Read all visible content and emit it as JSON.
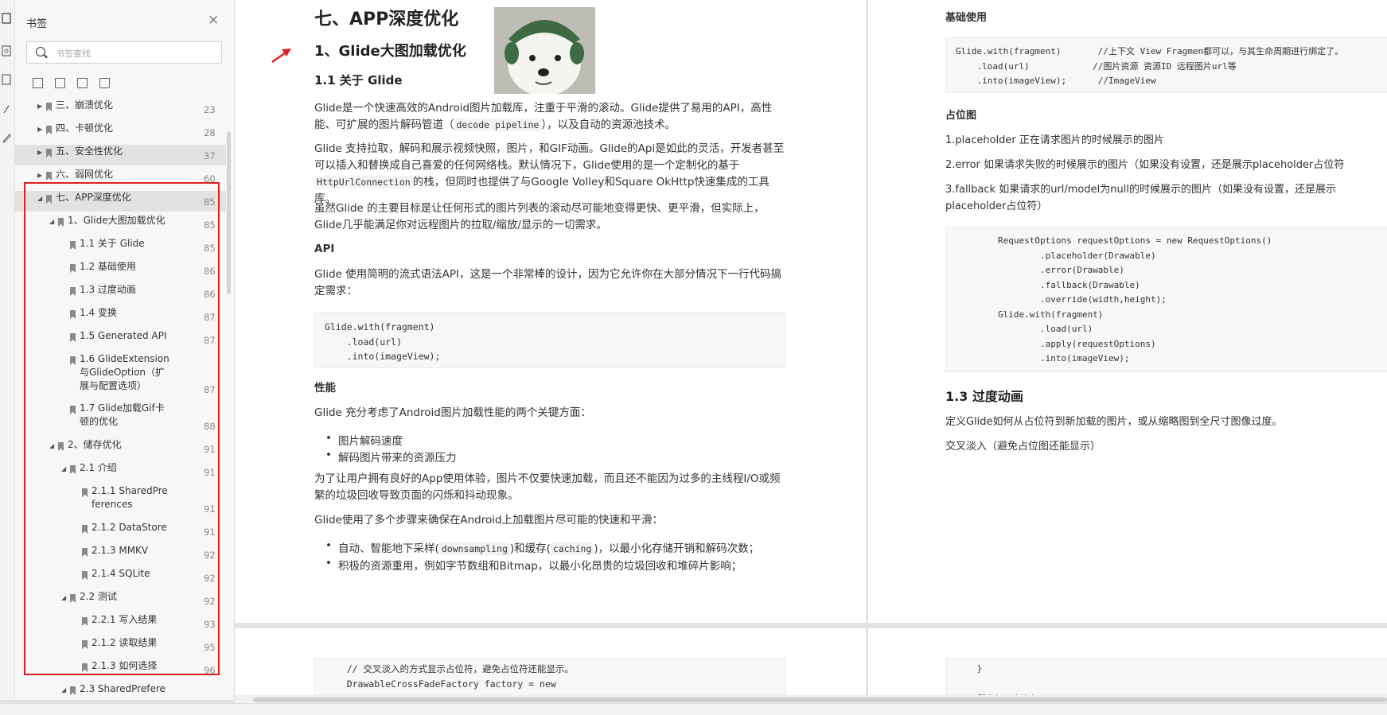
{
  "sidebar": {
    "title": "书签",
    "search_placeholder": "书签查找",
    "items": [
      {
        "label": "三、崩溃优化",
        "page": "23",
        "level": 0,
        "expanded": false,
        "highlight": false
      },
      {
        "label": "四、卡顿优化",
        "page": "28",
        "level": 0,
        "expanded": false,
        "highlight": false
      },
      {
        "label": "五、安全性优化",
        "page": "37",
        "level": 0,
        "expanded": false,
        "highlight": true
      },
      {
        "label": "六、弱网优化",
        "page": "60",
        "level": 0,
        "expanded": false,
        "highlight": false
      },
      {
        "label": "七、APP深度优化",
        "page": "85",
        "level": 0,
        "expanded": true,
        "highlight": true
      },
      {
        "label": "1、Glide大图加载优化",
        "page": "85",
        "level": 1,
        "expanded": true,
        "highlight": false
      },
      {
        "label": "1.1 关于 Glide",
        "page": "85",
        "level": 2,
        "highlight": false
      },
      {
        "label": "1.2 基础使用",
        "page": "86",
        "level": 2,
        "highlight": false
      },
      {
        "label": "1.3 过度动画",
        "page": "86",
        "level": 2,
        "highlight": false
      },
      {
        "label": "1.4 变换",
        "page": "87",
        "level": 2,
        "highlight": false
      },
      {
        "label": "1.5 Generated API",
        "page": "87",
        "level": 2,
        "highlight": false
      },
      {
        "label": "1.6 GlideExtension\n与GlideOption（扩\n展与配置选项）",
        "page": "87",
        "level": 2,
        "highlight": false
      },
      {
        "label": "1.7 Glide加载Gif卡\n顿的优化",
        "page": "88",
        "level": 2,
        "highlight": false
      },
      {
        "label": "2、储存优化",
        "page": "91",
        "level": 1,
        "expanded": true,
        "highlight": false
      },
      {
        "label": "2.1 介绍",
        "page": "91",
        "level": 2,
        "expanded": true,
        "highlight": false
      },
      {
        "label": "2.1.1 SharedPre\nferences",
        "page": "91",
        "level": 3,
        "highlight": false
      },
      {
        "label": "2.1.2 DataStore",
        "page": "91",
        "level": 3,
        "highlight": false
      },
      {
        "label": "2.1.3 MMKV",
        "page": "92",
        "level": 3,
        "highlight": false
      },
      {
        "label": "2.1.4 SQLite",
        "page": "92",
        "level": 3,
        "highlight": false
      },
      {
        "label": "2.2 测试",
        "page": "92",
        "level": 2,
        "expanded": true,
        "highlight": false
      },
      {
        "label": "2.2.1 写入结果",
        "page": "93",
        "level": 3,
        "highlight": false
      },
      {
        "label": "2.1.2 读取结果",
        "page": "95",
        "level": 3,
        "highlight": false
      },
      {
        "label": "2.1.3 如何选择",
        "page": "96",
        "level": 3,
        "highlight": false
      },
      {
        "label": "2.3 SharedPrefere",
        "page": "",
        "level": 2,
        "expanded": true,
        "highlight": false
      }
    ]
  },
  "page1": {
    "chapter_title": "七、APP深度优化",
    "section_title": "1、Glide大图加载优化",
    "sub_title": "1.1 关于 Glide",
    "para1": "Glide是一个快速高效的Android图片加载库，注重于平滑的滚动。Glide提供了易用的API，高性能、可扩展的图片解码管道（",
    "para1_code": "decode pipeline",
    "para1_tail": "），以及自动的资源池技术。",
    "para2": "Glide 支持拉取，解码和展示视频快照，图片，和GIF动画。Glide的Api是如此的灵活，开发者甚至可以插入和替换成自己喜爱的任何网络栈。默认情况下，Glide使用的是一个定制化的基于",
    "para2_code": "HttpUrlConnection",
    "para2_tail": "的栈，但同时也提供了与Google Volley和Square OkHttp快速集成的工具库。",
    "para3": "虽然Glide 的主要目标是让任何形式的图片列表的滚动尽可能地变得更快、更平滑，但实际上，Glide几乎能满足你对远程图片的拉取/缩放/显示的一切需求。",
    "api_heading": "API",
    "para4": "Glide 使用简明的流式语法API，这是一个非常棒的设计，因为它允许你在大部分情况下一行代码搞定需求：",
    "code1": "Glide.with(fragment)\n    .load(url)\n    .into(imageView);",
    "perf_heading": "性能",
    "para5": "Glide 充分考虑了Android图片加载性能的两个关键方面：",
    "bullet1": "图片解码速度",
    "bullet2": "解码图片带来的资源压力",
    "para6": "为了让用户拥有良好的App使用体验，图片不仅要快速加载，而且还不能因为过多的主线程I/O或频繁的垃圾回收导致页面的闪烁和抖动现象。",
    "para7": "Glide使用了多个步骤来确保在Android上加载图片尽可能的快速和平滑：",
    "bullet3_a": "自动、智能地下采样(",
    "bullet3_code1": "downsampling",
    "bullet3_b": ")和缓存(",
    "bullet3_code2": "caching",
    "bullet3_c": ")，以最小化存储开销和解码次数；",
    "bullet4": "积极的资源重用，例如字节数组和Bitmap，以最小化昂贵的垃圾回收和堆碎片影响；",
    "code_bottom": "    // 交叉淡入的方式显示占位符，避免占位符还能显示。\n    DrawableCrossFadeFactory factory = new"
  },
  "page2": {
    "basic_heading": "基础使用",
    "code1": "Glide.with(fragment)       //上下文 View Fragmen都可以，与其生命周期进行绑定了。\n    .load(url)            //图片资源 资源ID 远程图片url等\n    .into(imageView);      //ImageView",
    "placeholder_heading": "占位图",
    "item1": "1.placeholder      正在请求图片的时候展示的图片",
    "item2": "2.error               如果请求失败的时候展示的图片（如果没有设置，还是展示placeholder占位符",
    "item3": "3.fallback          如果请求的url/model为null的时候展示的图片（如果没有设置，还是展示placeholder占位符）",
    "code2": "        RequestOptions requestOptions = new RequestOptions()\n                .placeholder(Drawable)\n                .error(Drawable)\n                .fallback(Drawable)\n                .override(width,height);\n        Glide.with(fragment)\n                .load(url)\n                .apply(requestOptions)\n                .into(imageView);",
    "section_heading": "1.3 过度动画",
    "para1": "定义Glide如何从占位符到新加载的图片，或从缩略图到全尺寸图像过度。",
    "para2": "交叉淡入（避免占位图还能显示）",
    "code_bottom": "    }\n\n    Glide.with("
  }
}
